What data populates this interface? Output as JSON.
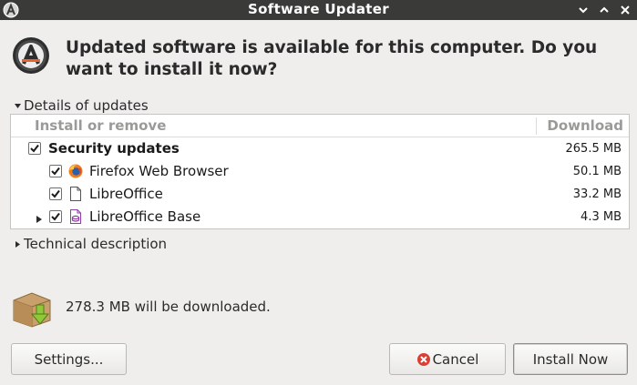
{
  "window": {
    "title": "Software Updater"
  },
  "header": {
    "headline": "Updated software is available for this computer. Do you want to install it now?"
  },
  "details_expander": {
    "label": "Details of updates",
    "expanded": true
  },
  "updates_list": {
    "columns": {
      "name": "Install or remove",
      "size": "Download"
    },
    "rows": [
      {
        "label": "Security updates",
        "size": "265.5 MB",
        "checked": true,
        "level": 0,
        "icon": "none",
        "bold": true
      },
      {
        "label": "Firefox Web Browser",
        "size": "50.1 MB",
        "checked": true,
        "level": 1,
        "icon": "firefox-icon"
      },
      {
        "label": "LibreOffice",
        "size": "33.2 MB",
        "checked": true,
        "level": 1,
        "icon": "document-icon"
      },
      {
        "label": "LibreOffice Base",
        "size": "4.3 MB",
        "checked": true,
        "level": 1,
        "icon": "libreoffice-base-icon",
        "expandable": true
      }
    ]
  },
  "technical_expander": {
    "label": "Technical description",
    "expanded": false
  },
  "status": {
    "text": "278.3 MB will be downloaded.",
    "icon": "package-download-icon"
  },
  "buttons": {
    "settings": "Settings...",
    "cancel": "Cancel",
    "install": "Install Now"
  },
  "colors": {
    "titlebar": "#3a3b39",
    "background": "#efeeec",
    "cancel_icon": "#d93f35",
    "firefox_orange": "#f27a1a",
    "base_purple": "#8e3fa6"
  }
}
